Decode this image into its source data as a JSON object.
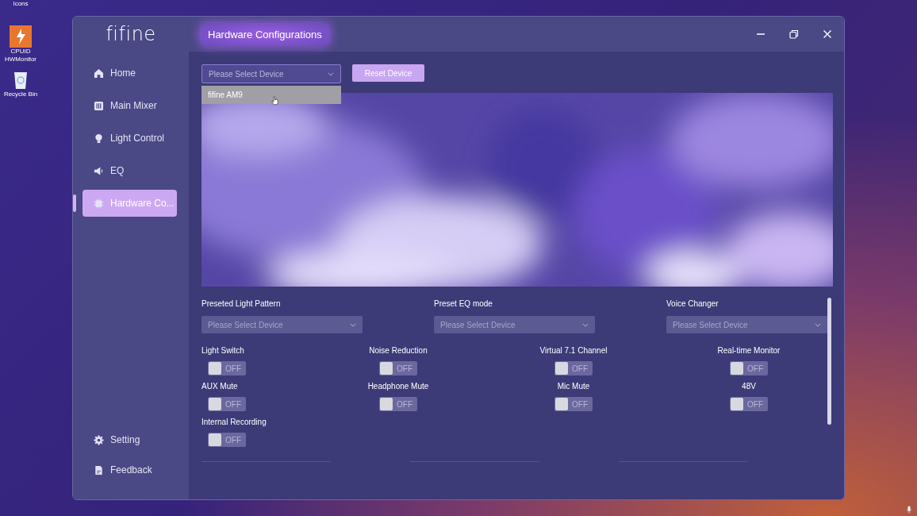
{
  "desktop_icons": [
    {
      "label": "Icons"
    },
    {
      "label": "CPUID HWMonitor"
    },
    {
      "label": "Recycle Bin"
    }
  ],
  "window": {
    "logo": "fifine",
    "title": "Hardware Configurations"
  },
  "sidebar": {
    "items": [
      {
        "label": "Home",
        "selected": false
      },
      {
        "label": "Main Mixer",
        "selected": false
      },
      {
        "label": "Light Control",
        "selected": false
      },
      {
        "label": "EQ",
        "selected": false
      },
      {
        "label": "Hardware Co...",
        "selected": true
      }
    ],
    "bottom_items": [
      {
        "label": "Setting"
      },
      {
        "label": "Feedback"
      }
    ]
  },
  "device_select": {
    "placeholder": "Please Select Device",
    "expanded": true,
    "options": [
      {
        "label": "fifine AM9",
        "hovered": true
      }
    ]
  },
  "reset_button": "Reset Device",
  "selects": [
    {
      "label": "Preseted Light Pattern",
      "placeholder": "Please Select Device"
    },
    {
      "label": "Preset EQ mode",
      "placeholder": "Please Select Device"
    },
    {
      "label": "Voice Changer",
      "placeholder": "Please Select Device"
    }
  ],
  "switches": [
    {
      "label": "Light Switch",
      "on": false,
      "state_text": "OFF"
    },
    {
      "label": "Noise Reduction",
      "on": false,
      "state_text": "OFF"
    },
    {
      "label": "Virtual 7.1 Channel",
      "on": false,
      "state_text": "OFF"
    },
    {
      "label": "Real-time Monitor",
      "on": false,
      "state_text": "OFF"
    },
    {
      "label": "AUX Mute",
      "on": false,
      "state_text": "OFF"
    },
    {
      "label": "Headphone Mute",
      "on": false,
      "state_text": "OFF"
    },
    {
      "label": "Mic Mute",
      "on": false,
      "state_text": "OFF"
    },
    {
      "label": "48V",
      "on": false,
      "state_text": "OFF"
    },
    {
      "label": "Internal Recording",
      "on": false,
      "state_text": "OFF"
    }
  ]
}
